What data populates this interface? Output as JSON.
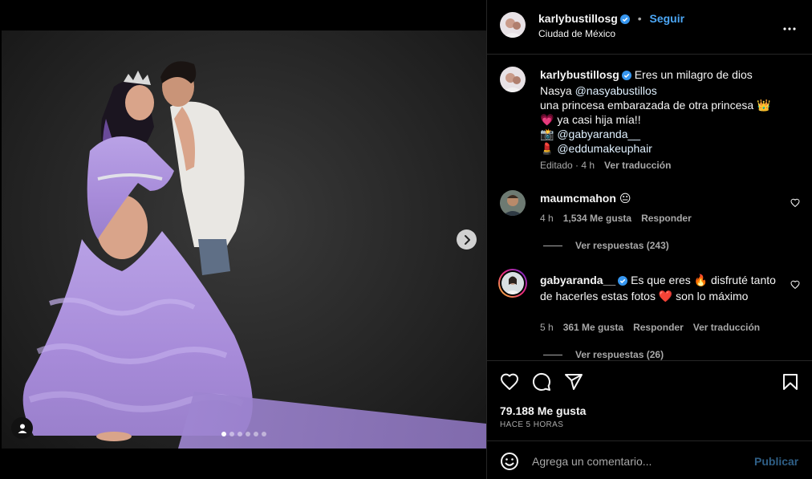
{
  "post": {
    "username": "karlybustillosg",
    "follow_label": "Seguir",
    "separator": "•",
    "location": "Ciudad de México",
    "photo_count": 6,
    "active_photo": 1
  },
  "caption": {
    "username": "karlybustillosg",
    "line1": "Eres un milagro de dios",
    "line2_prefix": "Nasya ",
    "line2_mention": "@nasyabustillos",
    "line3": "una princesa embarazada de otra princesa 👑",
    "line4": "💗 ya casi hija mía!!",
    "line5_emoji": "📸 ",
    "line5_mention": "@gabyaranda__",
    "line6_emoji": "💄 ",
    "line6_mention": "@eddumakeuphair",
    "edited": "Editado · 4 h",
    "translate": "Ver traducción"
  },
  "comments": [
    {
      "username": "maumcmahon",
      "text": "😐",
      "time": "4 h",
      "likes": "1,534 Me gusta",
      "reply": "Responder",
      "view_replies": "Ver respuestas (243)"
    },
    {
      "username": "gabyaranda__",
      "text": "Es que eres 🔥 disfruté tanto de hacerles estas fotos ❤️ son lo máximo",
      "time": "5 h",
      "likes": "361 Me gusta",
      "reply": "Responder",
      "translate": "Ver traducción",
      "view_replies": "Ver respuestas (26)"
    }
  ],
  "actions": {
    "icons": [
      "heart-icon",
      "comment-icon",
      "share-icon",
      "bookmark-icon"
    ],
    "likes": "79.188 Me gusta",
    "time_ago": "HACE 5 HORAS"
  },
  "comment_box": {
    "placeholder": "Agrega un comentario...",
    "publish_label": "Publicar"
  },
  "colors": {
    "background": "#000000",
    "border": "#262626",
    "muted_text": "#a8a8a8",
    "link_blue": "#4ca7f5",
    "publish_disabled": "#2f5f86",
    "verified_badge": "#3797f0",
    "dress_lavender": "#a98fd8"
  }
}
